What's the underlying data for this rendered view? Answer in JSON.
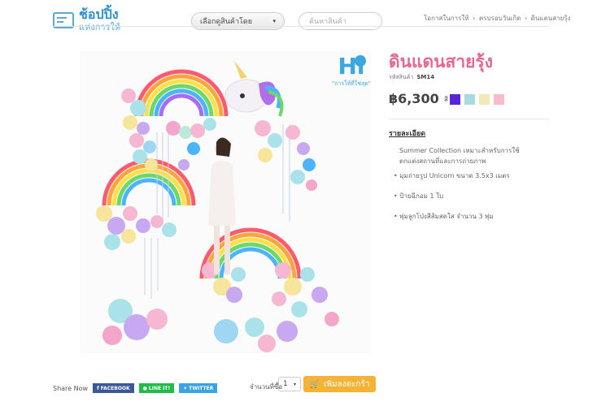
{
  "header": {
    "logo_title": "ช้อปปิ้ง",
    "logo_sub": "แห่งการให้",
    "category_select": "เลือกดูสินค้าโดย",
    "search_placeholder": "ค้นหาสินค้า",
    "breadcrumb": [
      "โอกาสในการให้",
      "ครบรอบวันเกิด",
      "ดินแดนสายรุ้ง"
    ]
  },
  "hero": {
    "hi_badge": "Hi",
    "hi_sub": "\"การให้ที่ใช่สุด\""
  },
  "product": {
    "title": "ดินแดนสายรุ้ง",
    "sku_label": "รหัสสินค้า",
    "sku": "SM14",
    "price": "฿6,300",
    "swatch_label": "สี",
    "swatches": [
      "#5a24d6",
      "#a8dbe0",
      "#f1eab8",
      "#f7bcc9"
    ],
    "detail_heading": "รายละเอียด",
    "description": "Summer Collection เหมาะสำหรับการใช้ตกแต่งสถานที่และการถ่ายภาพ",
    "bullets": [
      "มุมถ่ายรูป Unicorn ขนาด 3.5x3 เมตร",
      "ป้ายฉีกอม 1 ใบ",
      "พุ่มลูกโป่งสีส้มสดใส จำนวน 3 พุ่ม"
    ]
  },
  "share": {
    "label": "Share Now",
    "facebook": "FACEBOOK",
    "line": "LINE IT!",
    "twitter": "TWITTER"
  },
  "cart": {
    "qty_label": "จำนวนที่ซื้อ",
    "qty_value": "1",
    "add_button": "เพิ่มลงตะกร้า"
  }
}
